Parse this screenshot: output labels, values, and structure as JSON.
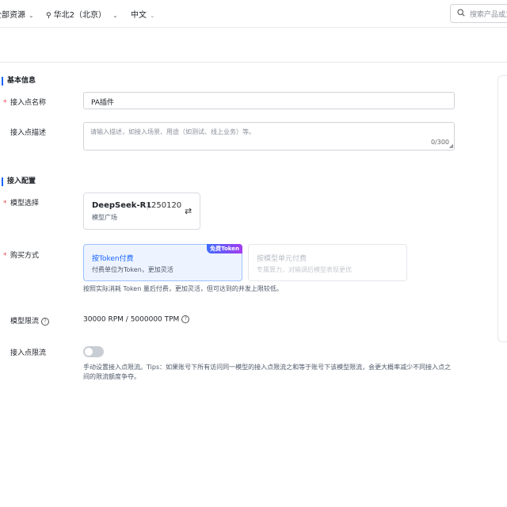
{
  "topbar": {
    "resources": "全部资源",
    "region": "华北2（北京）",
    "language": "中文",
    "search_placeholder": "搜索产品或文档"
  },
  "basic_info": {
    "section_title": "基本信息",
    "name_label": "接入点名称",
    "name_value": "PA插件",
    "desc_label": "接入点描述",
    "desc_placeholder": "请输入描述，如接入场景、用途（如测试、线上业务）等。",
    "desc_count": "0/300"
  },
  "access_config": {
    "section_title": "接入配置",
    "model_label": "模型选择",
    "model": {
      "name": "DeepSeek-R1",
      "version": "250120",
      "source": "模型广场"
    },
    "purchase_label": "购买方式",
    "purchase_options": [
      {
        "title": "按Token付费",
        "desc": "付费单位为Token，更加灵活",
        "badge": "免费Token",
        "selected": true
      },
      {
        "title": "按模型单元付费",
        "desc": "专属算力，对输调后模型表现更优",
        "selected": false
      }
    ],
    "purchase_help": "按照实际消耗 Token 量后付费，更加灵活，但可达到的并发上限较低。",
    "rate_limit_label": "模型限流",
    "rate_limit_value": "30000 RPM / 5000000 TPM",
    "endpoint_limit_label": "接入点限流",
    "endpoint_limit_enabled": false,
    "endpoint_limit_help": "手动设置接入点限流。Tips：如果账号下所有访问同一模型的接入点限流之和等于账号下该模型限流，会更大概率减少不同接入点之间的限流额度争夺。"
  },
  "colors": {
    "accent": "#1664ff",
    "required": "#e5484d"
  }
}
